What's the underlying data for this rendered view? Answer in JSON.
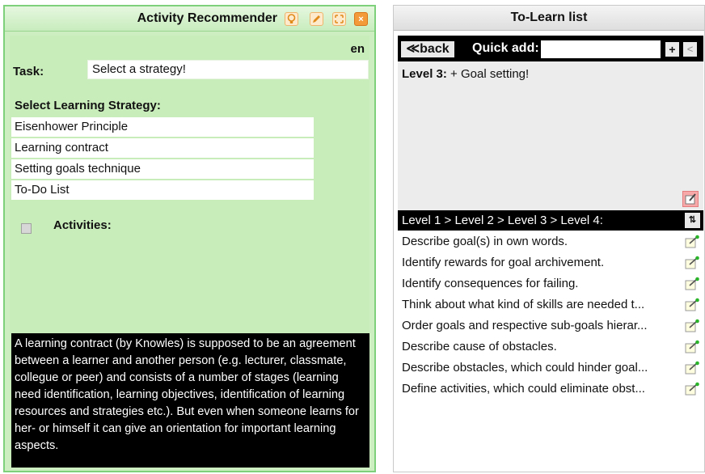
{
  "left_widget": {
    "title": "Activity Recommender",
    "close_glyph": "×",
    "language": "en",
    "task_label": "Task:",
    "task_value": "Select a strategy!",
    "strategy_heading": "Select Learning Strategy:",
    "strategies": [
      {
        "label": "Eisenhower Principle"
      },
      {
        "label": "Learning contract"
      },
      {
        "label": "Setting goals technique"
      },
      {
        "label": "To-Do List"
      }
    ],
    "activities_label": "Activities:",
    "description": "A learning contract (by Knowles) is supposed to be an agreement between a learner and another person (e.g. lecturer, classmate, collegue or peer) and consists of a number of stages (learning need identification, learning objectives, identification of learning resources and strategies etc.). But even when someone learns for her- or himself it can give an orientation for important learning aspects."
  },
  "right_widget": {
    "title": "To-Learn list",
    "back_label": "≪back",
    "quick_add_label": "Quick add:",
    "quick_add_value": "",
    "plus_label": "+",
    "minus_label": "<",
    "level_label": "Level 3:",
    "level_goal": "+ Goal setting!",
    "path": "Level 1 > Level 2 > Level 3 > Level 4:",
    "sort_label": "⇅",
    "subgoals": [
      {
        "text": "Describe goal(s) in own words."
      },
      {
        "text": "Identify rewards for goal archivement."
      },
      {
        "text": "Identify consequences for failing."
      },
      {
        "text": "Think about what kind of skills are needed t..."
      },
      {
        "text": "Order goals and respective sub-goals hierar..."
      },
      {
        "text": "Describe cause of obstacles."
      },
      {
        "text": "Describe obstacles, which could hinder goal..."
      },
      {
        "text": "Define activities, which could eliminate obst..."
      }
    ]
  },
  "icons": {
    "bulb": "lightbulb-icon",
    "edit": "pencil-icon",
    "resize": "resize-icon",
    "close": "close-icon",
    "note": "note-add-icon",
    "sort": "sort-icon"
  },
  "colors": {
    "left_bg": "#c9ecbb",
    "left_border": "#7fd07a",
    "accent_orange": "#f39a3a",
    "toolbar": "#000000"
  }
}
